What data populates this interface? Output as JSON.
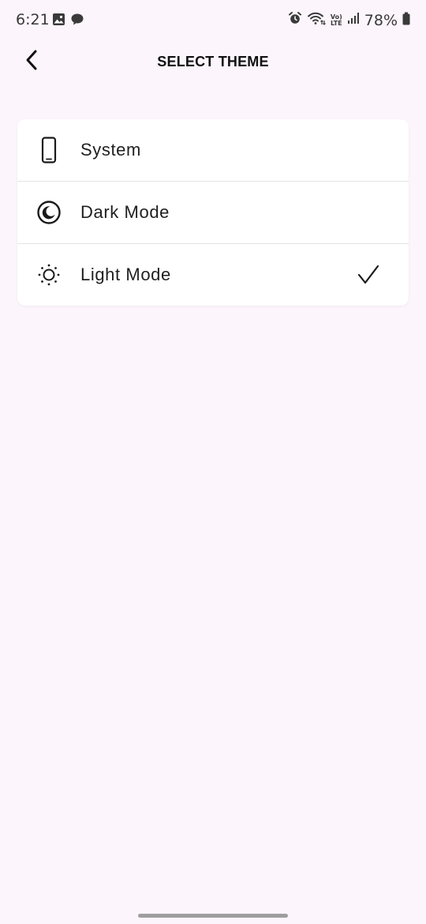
{
  "status_bar": {
    "time": "6:21",
    "battery_percent": "78%",
    "volte_top": "Vo)",
    "volte_bottom": "LTE"
  },
  "header": {
    "title": "SELECT THEME"
  },
  "theme_options": [
    {
      "label": "System",
      "icon": "phone-icon",
      "selected": false
    },
    {
      "label": "Dark Mode",
      "icon": "moon-icon",
      "selected": false
    },
    {
      "label": "Light Mode",
      "icon": "sun-icon",
      "selected": true
    }
  ],
  "colors": {
    "background": "#fcf5fc",
    "card": "#ffffff",
    "text": "#1f1f1f"
  }
}
